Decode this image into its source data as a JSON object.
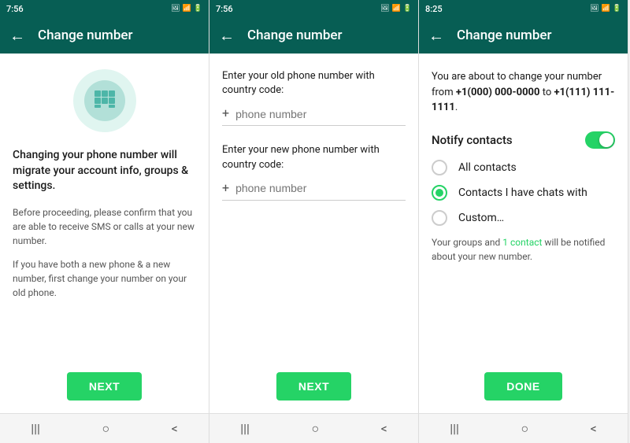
{
  "screens": [
    {
      "id": "screen1",
      "status_bar": {
        "time": "7:56",
        "icons": [
          "image",
          "signal",
          "wifi",
          "battery"
        ]
      },
      "top_bar": {
        "back_label": "←",
        "title": "Change number"
      },
      "content": {
        "main_text": "Changing your phone number will migrate your account info, groups & settings.",
        "sub_text1": "Before proceeding, please confirm that you are able to receive SMS or calls at your new number.",
        "sub_text2": "If you have both a new phone & a new number, first change your number on your old phone."
      },
      "button": {
        "label": "NEXT"
      },
      "nav": {
        "menu_icon": "|||",
        "home_icon": "○",
        "back_icon": "<"
      }
    },
    {
      "id": "screen2",
      "status_bar": {
        "time": "7:56",
        "icons": [
          "image",
          "signal",
          "wifi",
          "battery"
        ]
      },
      "top_bar": {
        "back_label": "←",
        "title": "Change number"
      },
      "content": {
        "old_label": "Enter your old phone number with country code:",
        "old_placeholder": "phone number",
        "new_label": "Enter your new phone number with country code:",
        "new_placeholder": "phone number"
      },
      "button": {
        "label": "NEXT"
      },
      "nav": {
        "menu_icon": "|||",
        "home_icon": "○",
        "back_icon": "<"
      }
    },
    {
      "id": "screen3",
      "status_bar": {
        "time": "8:25",
        "icons": [
          "image",
          "signal",
          "wifi",
          "battery"
        ]
      },
      "top_bar": {
        "back_label": "←",
        "title": "Change number"
      },
      "content": {
        "info_text": "You are about to change your number from",
        "old_number": "+1(000) 000-0000",
        "to_text": "to",
        "new_number": "+1(111) 111-1111",
        "notify_label": "Notify contacts",
        "radio_options": [
          {
            "id": "all",
            "label": "All contacts",
            "selected": false
          },
          {
            "id": "chats",
            "label": "Contacts I have chats with",
            "selected": true
          },
          {
            "id": "custom",
            "label": "Custom…",
            "selected": false
          }
        ],
        "groups_text": "Your groups and",
        "contact_count": "1 contact",
        "groups_text2": "will be notified about your new number."
      },
      "button": {
        "label": "DONE"
      },
      "nav": {
        "menu_icon": "|||",
        "home_icon": "○",
        "back_icon": "<"
      }
    }
  ]
}
